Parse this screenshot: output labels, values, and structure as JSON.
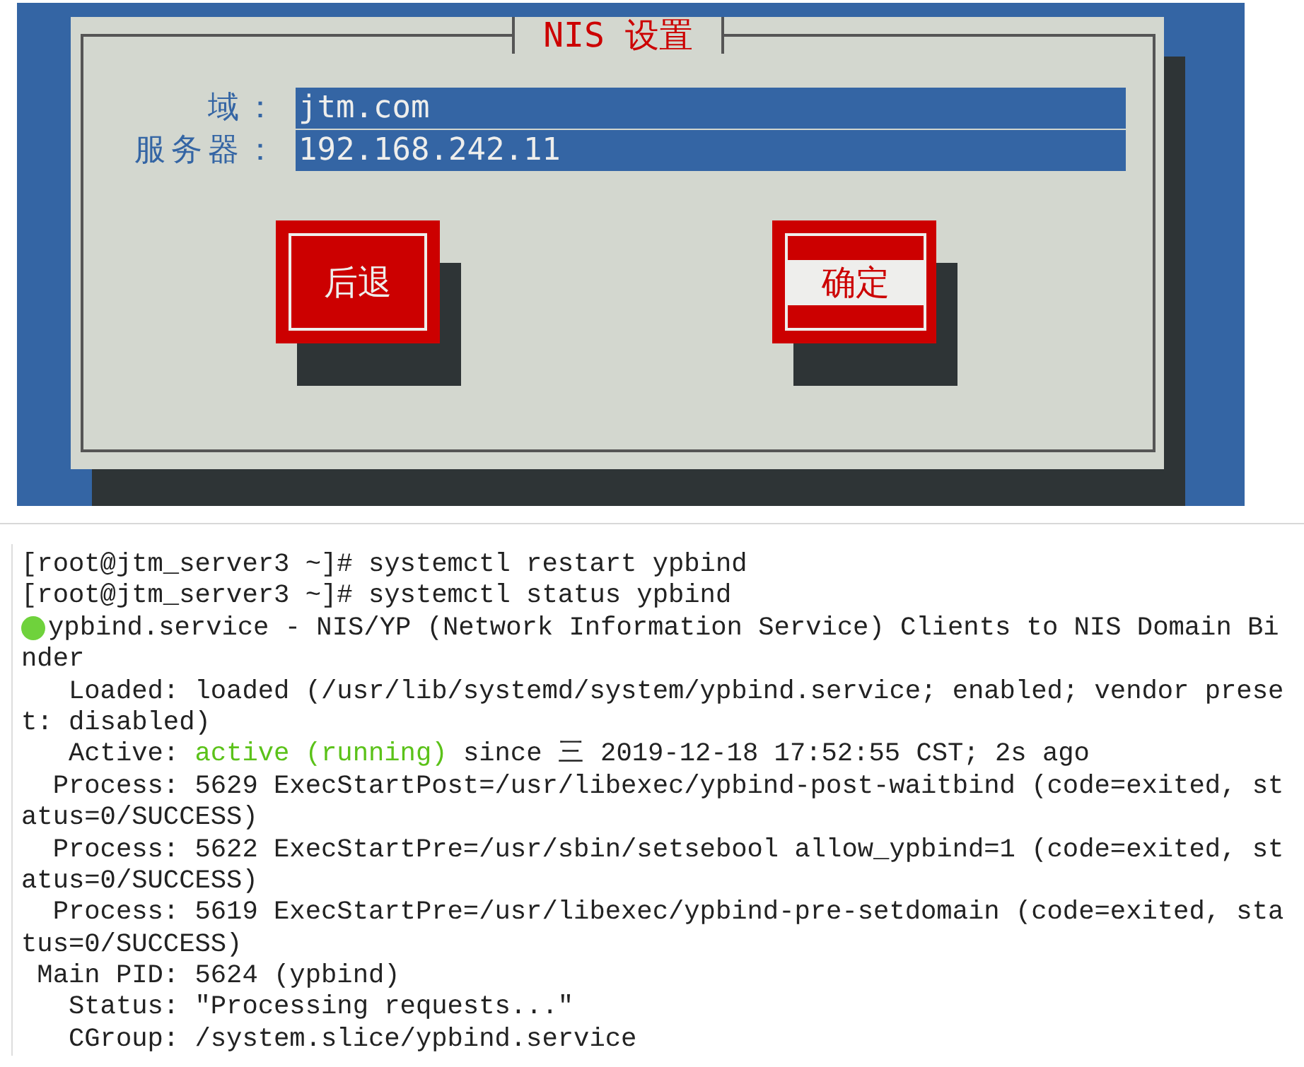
{
  "dialog": {
    "title": "NIS 设置",
    "fields": [
      {
        "label": "域：",
        "value": "jtm.com"
      },
      {
        "label": "服务器：",
        "value": "192.168.242.11"
      }
    ],
    "buttons": [
      {
        "label": "后退",
        "selected": false
      },
      {
        "label": "确定",
        "selected": true
      }
    ]
  },
  "terminal": {
    "lines": [
      {
        "parts": [
          {
            "kind": "plain",
            "text": "[root@jtm_server3 ~]# systemctl restart ypbind"
          }
        ]
      },
      {
        "parts": [
          {
            "kind": "plain",
            "text": "[root@jtm_server3 ~]# systemctl status ypbind"
          }
        ]
      },
      {
        "status_dot": {
          "color": "#6fd23c"
        },
        "parts": [
          {
            "kind": "plain",
            "text": "ypbind.service - NIS/YP (Network Information Service) Clients to NIS Domain Bi"
          }
        ]
      },
      {
        "parts": [
          {
            "kind": "plain",
            "text": "nder"
          }
        ]
      },
      {
        "parts": [
          {
            "kind": "plain",
            "text": "   Loaded: loaded (/usr/lib/systemd/system/ypbind.service; enabled; vendor prese"
          }
        ]
      },
      {
        "parts": [
          {
            "kind": "plain",
            "text": "t: disabled)"
          }
        ]
      },
      {
        "parts": [
          {
            "kind": "plain",
            "text": "   Active: "
          },
          {
            "kind": "active",
            "text": "active (running)"
          },
          {
            "kind": "plain",
            "text": " since 三 2019-12-18 17:52:55 CST; 2s ago"
          }
        ]
      },
      {
        "parts": [
          {
            "kind": "plain",
            "text": "  Process: 5629 ExecStartPost=/usr/libexec/ypbind-post-waitbind (code=exited, st"
          }
        ]
      },
      {
        "parts": [
          {
            "kind": "plain",
            "text": "atus=0/SUCCESS)"
          }
        ]
      },
      {
        "parts": [
          {
            "kind": "plain",
            "text": "  Process: 5622 ExecStartPre=/usr/sbin/setsebool allow_ypbind=1 (code=exited, st"
          }
        ]
      },
      {
        "parts": [
          {
            "kind": "plain",
            "text": "atus=0/SUCCESS)"
          }
        ]
      },
      {
        "parts": [
          {
            "kind": "plain",
            "text": "  Process: 5619 ExecStartPre=/usr/libexec/ypbind-pre-setdomain (code=exited, sta"
          }
        ]
      },
      {
        "parts": [
          {
            "kind": "plain",
            "text": "tus=0/SUCCESS)"
          }
        ]
      },
      {
        "parts": [
          {
            "kind": "plain",
            "text": " Main PID: 5624 (ypbind)"
          }
        ]
      },
      {
        "parts": [
          {
            "kind": "plain",
            "text": "   Status: \"Processing requests...\""
          }
        ]
      },
      {
        "parts": [
          {
            "kind": "plain",
            "text": "   CGroup: /system.slice/ypbind.service"
          }
        ]
      }
    ]
  }
}
